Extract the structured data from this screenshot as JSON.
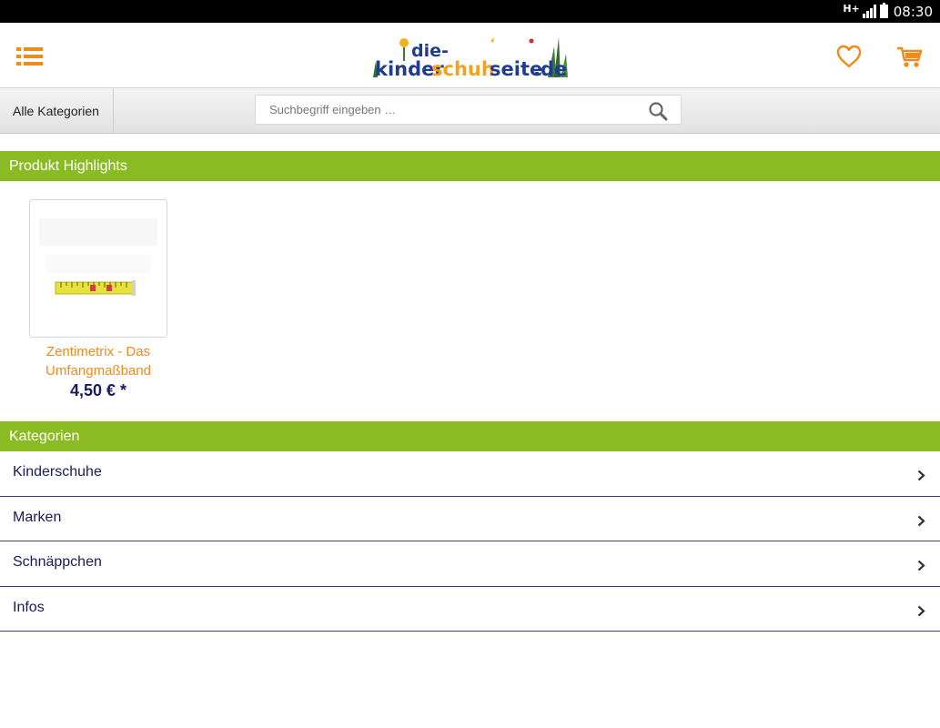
{
  "status_bar": {
    "network": "H+",
    "time": "08:30"
  },
  "header": {
    "logo": {
      "prefix": "die-",
      "part1": "kinder",
      "part2": "schuh",
      "part3": "seite",
      "suffix": ".de"
    },
    "icons": [
      "menu-list-icon",
      "heart-icon",
      "cart-icon"
    ]
  },
  "search": {
    "category_label": "Alle Kategorien",
    "placeholder": "Suchbegriff eingeben …"
  },
  "highlights": {
    "title": "Produkt Highlights",
    "products": [
      {
        "name": "Zentimetrix - Das Umfangmaßband",
        "price": "4,50 € *"
      }
    ]
  },
  "categories": {
    "title": "Kategorien",
    "items": [
      {
        "label": "Kinderschuhe"
      },
      {
        "label": "Marken"
      },
      {
        "label": "Schnäppchen"
      },
      {
        "label": "Infos"
      }
    ]
  },
  "colors": {
    "accent_orange": "#f08a1c",
    "section_green": "#8bbb22",
    "text_navy": "#1a1a5e"
  }
}
